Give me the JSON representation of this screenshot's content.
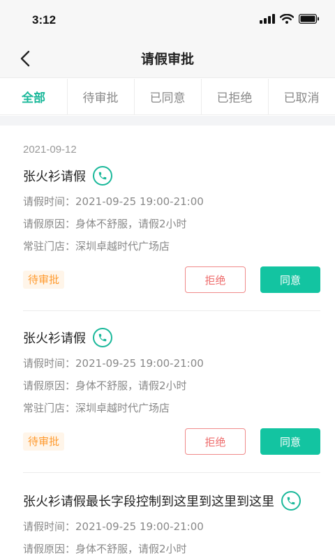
{
  "status_bar": {
    "time": "3:12"
  },
  "nav": {
    "title": "请假审批"
  },
  "tabs": [
    {
      "label": "全部",
      "active": true
    },
    {
      "label": "待审批",
      "active": false
    },
    {
      "label": "已同意",
      "active": false
    },
    {
      "label": "已拒绝",
      "active": false
    },
    {
      "label": "已取消",
      "active": false
    }
  ],
  "list": {
    "date": "2021-09-12",
    "items": [
      {
        "name": "张火衫请假",
        "time_label": "请假时间：",
        "time_value": "2021-09-25 19:00-21:00",
        "reason_label": "请假原因：",
        "reason_value": "身体不舒服，请假2小时",
        "store_label": "常驻门店：",
        "store_value": "深圳卓越时代广场店",
        "status": "待审批",
        "reject_label": "拒绝",
        "approve_label": "同意"
      },
      {
        "name": "张火衫请假",
        "time_label": "请假时间：",
        "time_value": "2021-09-25 19:00-21:00",
        "reason_label": "请假原因：",
        "reason_value": "身体不舒服，请假2小时",
        "store_label": "常驻门店：",
        "store_value": "深圳卓越时代广场店",
        "status": "待审批",
        "reject_label": "拒绝",
        "approve_label": "同意"
      },
      {
        "name": "张火衫请假最长字段控制到这里到这里到这里",
        "time_label": "请假时间：",
        "time_value": "2021-09-25 19:00-21:00",
        "reason_label": "请假原因：",
        "reason_value": "身体不舒服，请假2小时"
      }
    ]
  },
  "colors": {
    "accent": "#13c4a1",
    "reject": "#ee6b6b",
    "pending": "#ff9a2e"
  },
  "icons": {
    "back": "chevron-left-icon",
    "phone": "phone-icon",
    "signal": "signal-icon",
    "wifi": "wifi-icon",
    "battery": "battery-icon"
  }
}
